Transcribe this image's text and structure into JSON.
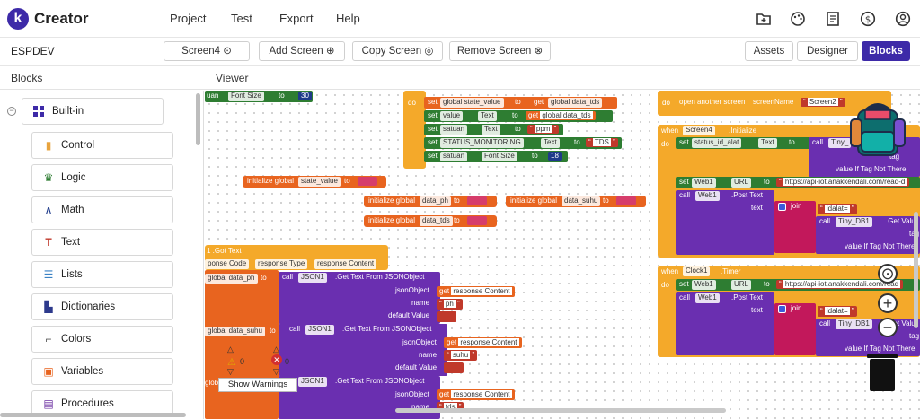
{
  "app": {
    "logo_letter": "k",
    "brand": "Creator"
  },
  "menu": [
    "Project",
    "Test",
    "Export",
    "Help"
  ],
  "top_icons": [
    "folder-add-icon",
    "palette-icon",
    "book-icon",
    "dollar-icon",
    "account-icon"
  ],
  "project": {
    "name": "ESPDEV"
  },
  "screen_bar": {
    "current_screen": "Screen4",
    "add": "Add Screen",
    "copy": "Copy Screen",
    "remove": "Remove Screen"
  },
  "view_toggle": {
    "assets": "Assets",
    "designer": "Designer",
    "blocks": "Blocks"
  },
  "blocks_panel": {
    "title": "Blocks",
    "builtin": "Built-in",
    "categories": [
      {
        "label": "Control",
        "icon": "control-icon",
        "color": "#e8a33d"
      },
      {
        "label": "Logic",
        "icon": "logic-icon",
        "color": "#2e7d32"
      },
      {
        "label": "Math",
        "icon": "math-icon",
        "color": "#1e3a8a"
      },
      {
        "label": "Text",
        "icon": "text-icon",
        "color": "#c0392b"
      },
      {
        "label": "Lists",
        "icon": "lists-icon",
        "color": "#3b82c4"
      },
      {
        "label": "Dictionaries",
        "icon": "dictionaries-icon",
        "color": "#2d3a8c"
      },
      {
        "label": "Colors",
        "icon": "colors-icon",
        "color": "#555555"
      },
      {
        "label": "Variables",
        "icon": "variables-icon",
        "color": "#e8641f"
      },
      {
        "label": "Procedures",
        "icon": "procedures-icon",
        "color": "#6b2fa0"
      }
    ]
  },
  "viewer": {
    "title": "Viewer",
    "show_warnings": "Show Warnings",
    "warn_count": "0",
    "error_count": "0"
  },
  "blocks": {
    "top_partial": {
      "prefix": "uan",
      "prop": "Font Size",
      "to": "to",
      "num": "30"
    },
    "sets": [
      {
        "do": "do",
        "set": "set",
        "var": "global state_value",
        "to": "to",
        "get": "get",
        "val": "global data_tds"
      },
      {
        "set": "set",
        "comp": "value",
        "prop": "Text",
        "to": "to",
        "get": "get",
        "val": "global data_tds"
      },
      {
        "set": "set",
        "comp": "satuan",
        "prop": "Text",
        "to": "to",
        "val": "ppm"
      },
      {
        "set": "set",
        "comp": "STATUS_MONITORING",
        "prop": "Text",
        "to": "to",
        "val": "TDS"
      },
      {
        "set": "set",
        "comp": "satuan",
        "prop": "Font Size",
        "to": "to",
        "val": "18"
      }
    ],
    "inits": [
      {
        "label": "initialize global",
        "name": "state_value",
        "to": "to"
      },
      {
        "label": "initialize global",
        "name": "data_ph",
        "to": "to"
      },
      {
        "label": "initialize global",
        "name": "data_suhu",
        "to": "to"
      },
      {
        "label": "initialize global",
        "name": "data_tds",
        "to": "to"
      }
    ],
    "got_text": {
      "head": "1 .Got Text",
      "params": [
        "ponse Code",
        "response Type",
        "response Content"
      ]
    },
    "json_calls": [
      {
        "var": "global data_ph",
        "to": "to",
        "call": "call",
        "comp": "JSON1",
        "method": ".Get Text From JSONObject",
        "jsonObject": "jsonObject",
        "get": "get",
        "content": "response Content",
        "name_lbl": "name",
        "name": "ph",
        "default": "default Value"
      },
      {
        "var": "global data_suhu",
        "to": "to",
        "call": "call",
        "comp": "JSON1",
        "method": ".Get Text From JSONObject",
        "jsonObject": "jsonObject",
        "get": "get",
        "content": "response Content",
        "name_lbl": "name",
        "name": "suhu",
        "default": "default Value"
      },
      {
        "var": "globa",
        "call": "call",
        "comp": "JSON1",
        "method": ".Get Text From JSONObject",
        "jsonObject": "jsonObject",
        "get": "get",
        "content": "response Content",
        "name_lbl": "name",
        "name": "tds"
      }
    ],
    "right_top": {
      "do": "do",
      "text": "open another screen",
      "screenName": "screenName",
      "screen": "Screen2"
    },
    "init_block": {
      "when": "when",
      "comp": "Screen4",
      "event": ".Initialize",
      "do": "do",
      "set": "set",
      "var": "status_id_alat",
      "prop": "Text",
      "to": "to",
      "call": "call",
      "tiny": "Tiny_",
      "tag": "tag",
      "tag_not": "value If Tag Not There",
      "web_set": "set",
      "web": "Web1",
      "url_prop": "URL",
      "url_to": "to",
      "url": "https://api-iot.anakkendali.com/read-d",
      "post": "call",
      "post_web": "Web1",
      "post_method": ".Post Text",
      "text_lbl": "text",
      "join": "join",
      "idalat": "idalat=",
      "tiny2": "Tiny_DB1",
      "get_val": ".Get Valu",
      "tag2": "tag",
      "tag_not2": "value If Tag Not There"
    },
    "timer_block": {
      "when": "when",
      "comp": "Clock1",
      "event": ".Timer",
      "do": "do",
      "set": "set",
      "web": "Web1",
      "url_prop": "URL",
      "to": "to",
      "url": "https://api-iot.anakkendali.com/read",
      "post": "call",
      "post_web": "Web1",
      "post_method": ".Post Text",
      "text_lbl": "text",
      "join": "join",
      "idalat": "idalat=",
      "tiny": "Tiny_DB1",
      "get_val": ".Get Valu",
      "tag": "tag",
      "tag_not": "value If Tag Not There"
    }
  }
}
